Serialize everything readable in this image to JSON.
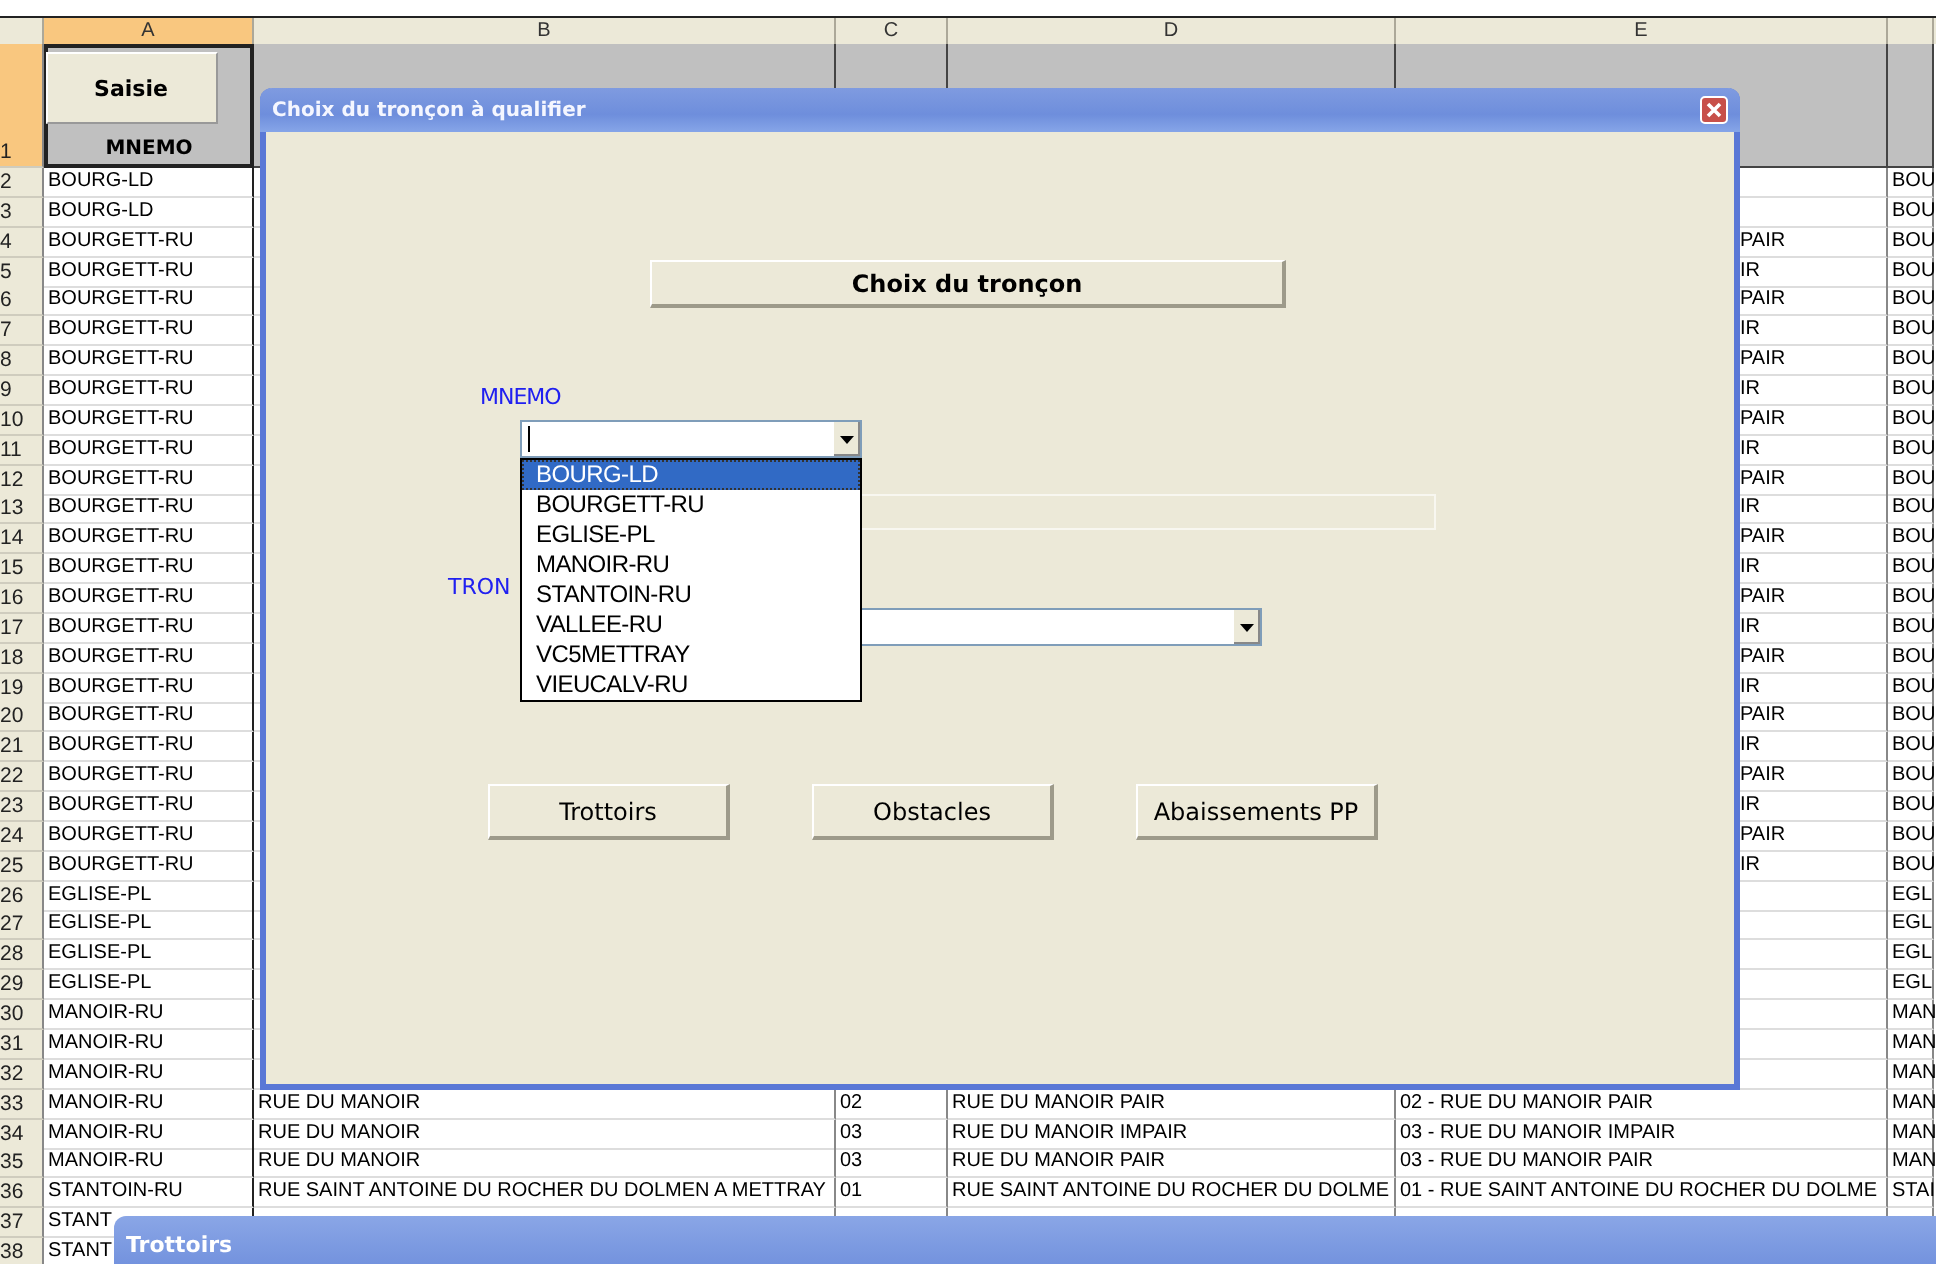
{
  "sheet": {
    "columns": [
      {
        "label": "A",
        "selected": true
      },
      {
        "label": "B",
        "selected": false
      },
      {
        "label": "C",
        "selected": false
      },
      {
        "label": "D",
        "selected": false
      },
      {
        "label": "E",
        "selected": false
      }
    ],
    "header_row": {
      "num": "1",
      "button": "Saisie",
      "label": "MNEMO"
    },
    "rows": [
      {
        "num": "2",
        "a": "BOURG-LD",
        "f": "BOU"
      },
      {
        "num": "3",
        "a": "BOURG-LD",
        "f": "BOU"
      },
      {
        "num": "4",
        "a": "BOURGETT-RU",
        "e": "PAIR",
        "f": "BOU"
      },
      {
        "num": "5",
        "a": "BOURGETT-RU",
        "e": "IR",
        "f": "BOU"
      },
      {
        "num": "6",
        "a": "BOURGETT-RU",
        "e": "PAIR",
        "f": "BOU"
      },
      {
        "num": "7",
        "a": "BOURGETT-RU",
        "e": "IR",
        "f": "BOU"
      },
      {
        "num": "8",
        "a": "BOURGETT-RU",
        "e": "PAIR",
        "f": "BOU"
      },
      {
        "num": "9",
        "a": "BOURGETT-RU",
        "e": "IR",
        "f": "BOU"
      },
      {
        "num": "10",
        "a": "BOURGETT-RU",
        "e": "PAIR",
        "f": "BOU"
      },
      {
        "num": "11",
        "a": "BOURGETT-RU",
        "e": "IR",
        "f": "BOU"
      },
      {
        "num": "12",
        "a": "BOURGETT-RU",
        "e": "PAIR",
        "f": "BOU"
      },
      {
        "num": "13",
        "a": "BOURGETT-RU",
        "e": "IR",
        "f": "BOU"
      },
      {
        "num": "14",
        "a": "BOURGETT-RU",
        "e": "PAIR",
        "f": "BOU"
      },
      {
        "num": "15",
        "a": "BOURGETT-RU",
        "e": "IR",
        "f": "BOU"
      },
      {
        "num": "16",
        "a": "BOURGETT-RU",
        "e": "PAIR",
        "f": "BOU"
      },
      {
        "num": "17",
        "a": "BOURGETT-RU",
        "e": "IR",
        "f": "BOU"
      },
      {
        "num": "18",
        "a": "BOURGETT-RU",
        "e": "PAIR",
        "f": "BOU"
      },
      {
        "num": "19",
        "a": "BOURGETT-RU",
        "e": "IR",
        "f": "BOU"
      },
      {
        "num": "20",
        "a": "BOURGETT-RU",
        "e": "PAIR",
        "f": "BOU"
      },
      {
        "num": "21",
        "a": "BOURGETT-RU",
        "e": "IR",
        "f": "BOU"
      },
      {
        "num": "22",
        "a": "BOURGETT-RU",
        "e": "PAIR",
        "f": "BOU"
      },
      {
        "num": "23",
        "a": "BOURGETT-RU",
        "e": "IR",
        "f": "BOU"
      },
      {
        "num": "24",
        "a": "BOURGETT-RU",
        "e": "PAIR",
        "f": "BOU"
      },
      {
        "num": "25",
        "a": "BOURGETT-RU",
        "e": "IR",
        "f": "BOU"
      },
      {
        "num": "26",
        "a": "EGLISE-PL",
        "f": "EGL"
      },
      {
        "num": "27",
        "a": "EGLISE-PL",
        "f": "EGL"
      },
      {
        "num": "28",
        "a": "EGLISE-PL",
        "f": "EGL"
      },
      {
        "num": "29",
        "a": "EGLISE-PL",
        "f": "EGL"
      },
      {
        "num": "30",
        "a": "MANOIR-RU",
        "f": "MAN"
      },
      {
        "num": "31",
        "a": "MANOIR-RU",
        "f": "MAN"
      },
      {
        "num": "32",
        "a": "MANOIR-RU",
        "f": "MAN"
      },
      {
        "num": "33",
        "a": "MANOIR-RU",
        "b": "RUE DU MANOIR",
        "c": "02",
        "d": "RUE DU MANOIR PAIR",
        "e": "02 - RUE DU MANOIR PAIR",
        "f": "MAN"
      },
      {
        "num": "34",
        "a": "MANOIR-RU",
        "b": "RUE DU MANOIR",
        "c": "03",
        "d": "RUE DU MANOIR IMPAIR",
        "e": "03 - RUE DU MANOIR IMPAIR",
        "f": "MAN"
      },
      {
        "num": "35",
        "a": "MANOIR-RU",
        "b": "RUE DU MANOIR",
        "c": "03",
        "d": "RUE DU MANOIR PAIR",
        "e": "03 - RUE DU MANOIR PAIR",
        "f": "MAN"
      },
      {
        "num": "36",
        "a": "STANTOIN-RU",
        "b": "RUE SAINT ANTOINE DU ROCHER DU DOLMEN A METTRAY",
        "c": "01",
        "d": "RUE SAINT ANTOINE DU ROCHER DU DOLME",
        "e": "01 - RUE SAINT ANTOINE DU ROCHER DU DOLME",
        "f": "STAI"
      },
      {
        "num": "37",
        "a": "STANT"
      },
      {
        "num": "38",
        "a": "STANT"
      }
    ]
  },
  "dialog": {
    "title": "Choix du tronçon à qualifier",
    "heading_button": "Choix du tronçon",
    "mnemo_label": "MNEMO",
    "mnemo_options": [
      {
        "label": "BOURG-LD",
        "selected": true
      },
      {
        "label": "BOURGETT-RU",
        "selected": false
      },
      {
        "label": "EGLISE-PL",
        "selected": false
      },
      {
        "label": "MANOIR-RU",
        "selected": false
      },
      {
        "label": "STANTOIN-RU",
        "selected": false
      },
      {
        "label": "VALLEE-RU",
        "selected": false
      },
      {
        "label": "VC5METTRAY",
        "selected": false
      },
      {
        "label": "VIEUCALV-RU",
        "selected": false
      }
    ],
    "troncon_label": "TRON",
    "buttons": [
      "Trottoirs",
      "Obstacles",
      "Abaissements PP"
    ]
  },
  "window2": {
    "title": "Trottoirs"
  }
}
